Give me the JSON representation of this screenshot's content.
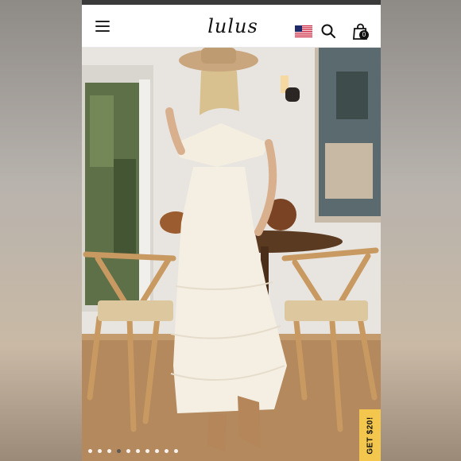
{
  "header": {
    "logo_text": "lulus",
    "cart_count": "0",
    "icons": [
      "menu-icon",
      "us-flag-icon",
      "search-icon",
      "shopping-bag-icon"
    ]
  },
  "gallery": {
    "slide_count": 10,
    "active_slide": 4
  },
  "promo": {
    "label": "GET $20!",
    "color": "#f3c74e"
  }
}
